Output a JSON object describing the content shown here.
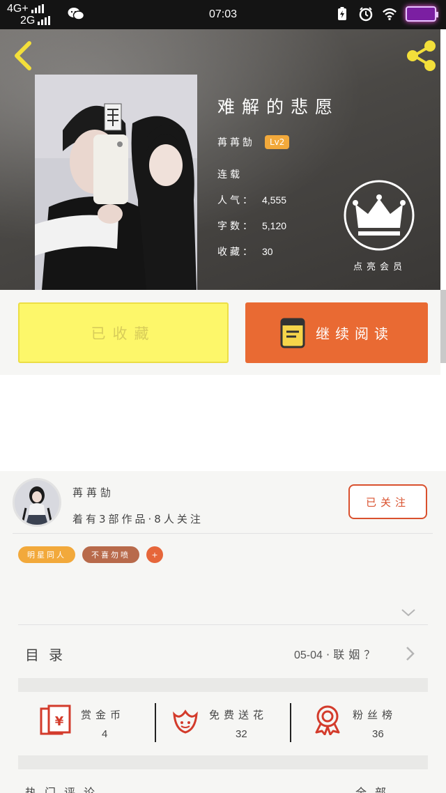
{
  "status_bar": {
    "network_1": "4G+",
    "network_2": "2G",
    "time": "07:03"
  },
  "book": {
    "title": "难解的悲愿",
    "author": "苒苒勂",
    "author_level": "Lv2",
    "status": "连载",
    "popularity_label": "人气",
    "popularity": "4,555",
    "word_count_label": "字数",
    "word_count": "5,120",
    "favorites_label": "收藏",
    "favorites": "30",
    "crown_label": "点亮会员"
  },
  "actions": {
    "collected_label": "已收藏",
    "continue_label": "继续阅读"
  },
  "author_card": {
    "name": "苒苒勂",
    "meta": "着有3部作品·8人关注",
    "follow_label": "已关注"
  },
  "tags": [
    "明星同人",
    "不喜勿喷",
    "+"
  ],
  "toc": {
    "label": "目录",
    "latest_date": "05-04",
    "latest_title": "联姻？"
  },
  "stats": [
    {
      "name": "赏金币",
      "value": "4",
      "icon": "red-envelope-icon"
    },
    {
      "name": "免费送花",
      "value": "32",
      "icon": "flower-icon"
    },
    {
      "name": "粉丝榜",
      "value": "36",
      "icon": "medal-icon"
    }
  ],
  "bottom": {
    "hot_comments_label": "热门评论",
    "all_label": "全部"
  },
  "colors": {
    "accent_orange": "#e96a33",
    "collect_yellow": "#fdf76a",
    "level_badge": "#f2a93b",
    "follow_red": "#d9502d"
  }
}
